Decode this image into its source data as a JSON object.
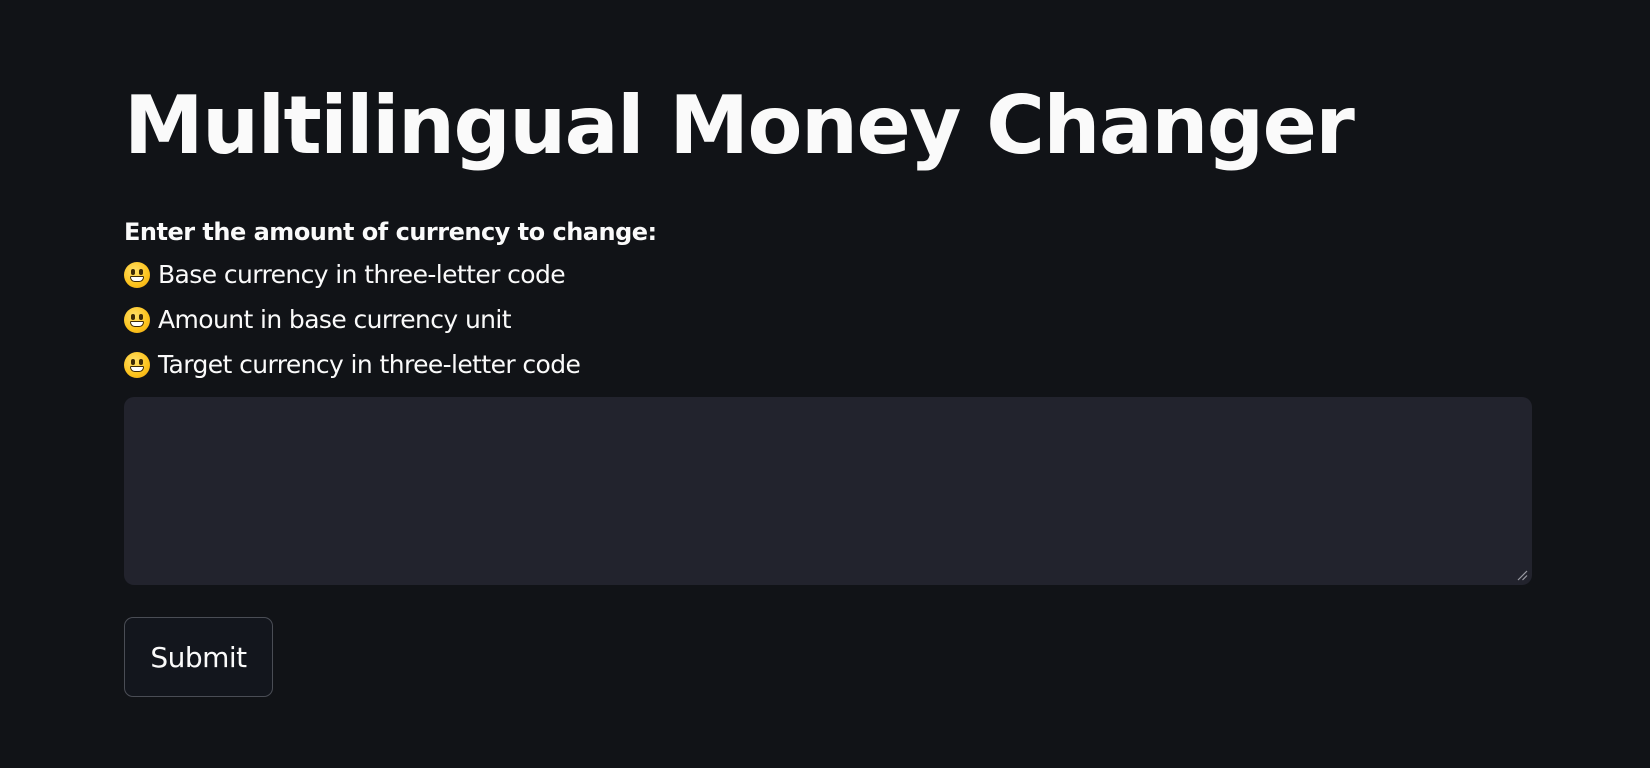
{
  "app": {
    "title": "Multilingual Money Changer"
  },
  "instructions": {
    "heading": "Enter the amount of currency to change:",
    "items": [
      {
        "icon": "grinning-face-icon",
        "text": "Base currency in three-letter code"
      },
      {
        "icon": "grinning-face-icon",
        "text": "Amount in base currency unit"
      },
      {
        "icon": "grinning-face-icon",
        "text": "Target currency in three-letter code"
      }
    ]
  },
  "input": {
    "value": "",
    "placeholder": ""
  },
  "form": {
    "submit_label": "Submit"
  },
  "colors": {
    "background": "#111317",
    "text": "#fafafa",
    "input_background": "#22232d",
    "button_border": "#4a4d55"
  }
}
